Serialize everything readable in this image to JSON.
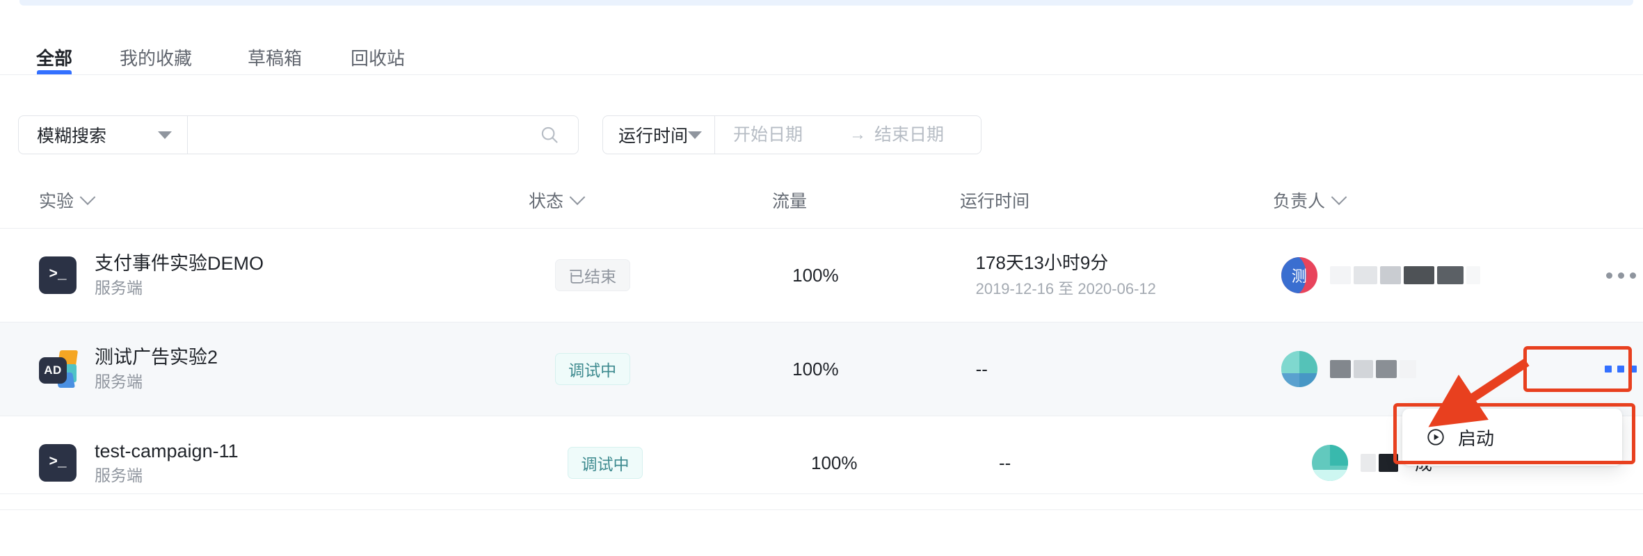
{
  "tabs": [
    {
      "label": "全部",
      "active": true
    },
    {
      "label": "我的收藏",
      "active": false
    },
    {
      "label": "草稿箱",
      "active": false
    },
    {
      "label": "回收站",
      "active": false
    }
  ],
  "filters": {
    "search_type": "模糊搜索",
    "search_value": "",
    "search_placeholder": "",
    "search_icon": "search-icon",
    "date_type": "运行时间",
    "start_placeholder": "开始日期",
    "start_value": "",
    "range_separator": "→",
    "end_placeholder": "结束日期",
    "end_value": "",
    "calendar_icon": "calendar-icon"
  },
  "table": {
    "columns": [
      {
        "label": "实验",
        "sortable": true
      },
      {
        "label": "状态",
        "sortable": true
      },
      {
        "label": "流量",
        "sortable": false
      },
      {
        "label": "运行时间",
        "sortable": false
      },
      {
        "label": "负责人",
        "sortable": true
      }
    ],
    "rows": [
      {
        "icon": "terminal-icon",
        "icon_text": ">_",
        "name": "支付事件实验DEMO",
        "type": "服务端",
        "status": "已结束",
        "status_style": "ended",
        "traffic": "100%",
        "runtime": "178天13小时9分",
        "runtime_range": "2019-12-16 至 2020-06-12",
        "owner_avatar_text": "测",
        "owner_name": "",
        "owner_tail": "",
        "highlighted": false
      },
      {
        "icon": "ad-icon",
        "icon_text": "AD",
        "name": "测试广告实验2",
        "type": "服务端",
        "status": "调试中",
        "status_style": "debug",
        "traffic": "100%",
        "runtime": "--",
        "runtime_range": "",
        "owner_avatar_text": "",
        "owner_name": "",
        "owner_tail": "",
        "highlighted": true
      },
      {
        "icon": "terminal-icon",
        "icon_text": ">_",
        "name": "test-campaign-11",
        "type": "服务端",
        "status": "调试中",
        "status_style": "debug",
        "traffic": "100%",
        "runtime": "--",
        "runtime_range": "",
        "owner_avatar_text": "",
        "owner_name": "",
        "owner_tail": "成",
        "highlighted": false
      }
    ]
  },
  "action_menu": {
    "items": [
      {
        "label": "启动",
        "icon": "play-circle-icon"
      }
    ]
  },
  "annotations": {
    "accent_color": "#e8401f",
    "dots_label": "...",
    "highlight_targets": [
      "more-actions-button",
      "action-menu-item-start"
    ]
  },
  "colors": {
    "primary": "#3370ff",
    "text": "#1f2329",
    "muted": "#8f959e",
    "border": "#eceef1",
    "row_highlight": "#f6f8fa",
    "badge_debug_text": "#3d8a8f",
    "badge_debug_bg": "#effbfa",
    "badge_ended_text": "#8f959e",
    "badge_ended_bg": "#f5f6f7",
    "annotation_red": "#e8401f"
  }
}
